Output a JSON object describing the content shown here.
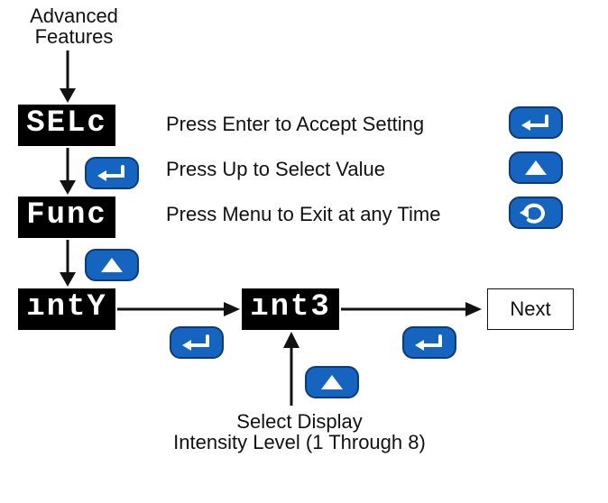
{
  "header": {
    "line1": "Advanced",
    "line2": "Features"
  },
  "legend": {
    "enter": "Press Enter to Accept Setting",
    "up": "Press Up to Select Value",
    "menu": "Press Menu to Exit at any Time"
  },
  "lcd": {
    "selc": "SELc",
    "func": "Func",
    "inty": "ıntY",
    "int3": "ınt3"
  },
  "next_label": "Next",
  "footer": {
    "line1": "Select Display",
    "line2": "Intensity Level (1 Through 8)"
  },
  "icons": {
    "enter": "enter-icon",
    "up": "up-icon",
    "menu": "menu-icon"
  }
}
